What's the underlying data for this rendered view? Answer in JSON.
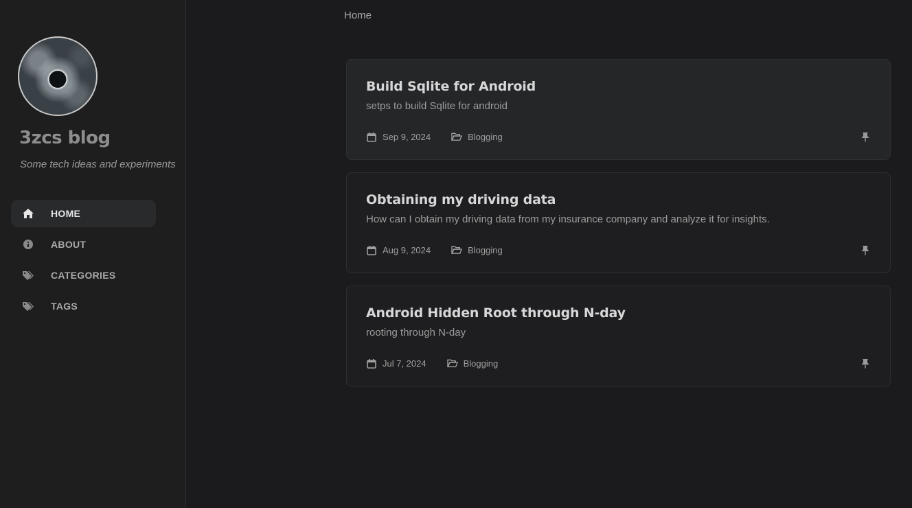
{
  "sidebar": {
    "site_title": "3zcs blog",
    "site_subtitle": "Some tech ideas and experiments",
    "nav": [
      {
        "label": "HOME",
        "icon": "home-icon",
        "active": true
      },
      {
        "label": "ABOUT",
        "icon": "info-icon",
        "active": false
      },
      {
        "label": "CATEGORIES",
        "icon": "tags-icon",
        "active": false
      },
      {
        "label": "TAGS",
        "icon": "tags-icon",
        "active": false
      }
    ]
  },
  "breadcrumb": "Home",
  "posts": [
    {
      "title": "Build Sqlite for Android",
      "description": "setps to build Sqlite for android",
      "date": "Sep 9, 2024",
      "category": "Blogging",
      "pinned": true
    },
    {
      "title": "Obtaining my driving data",
      "description": "How can I obtain my driving data from my insurance company and analyze it for insights.",
      "date": "Aug 9, 2024",
      "category": "Blogging",
      "pinned": true
    },
    {
      "title": "Android Hidden Root through N-day",
      "description": "rooting through N-day",
      "date": "Jul 7, 2024",
      "category": "Blogging",
      "pinned": true
    }
  ],
  "colors": {
    "background": "#1b1b1e",
    "sidebar_bg": "#1e1e1e",
    "active_nav_bg": "#282a2c",
    "card_border": "#2e2f31"
  }
}
